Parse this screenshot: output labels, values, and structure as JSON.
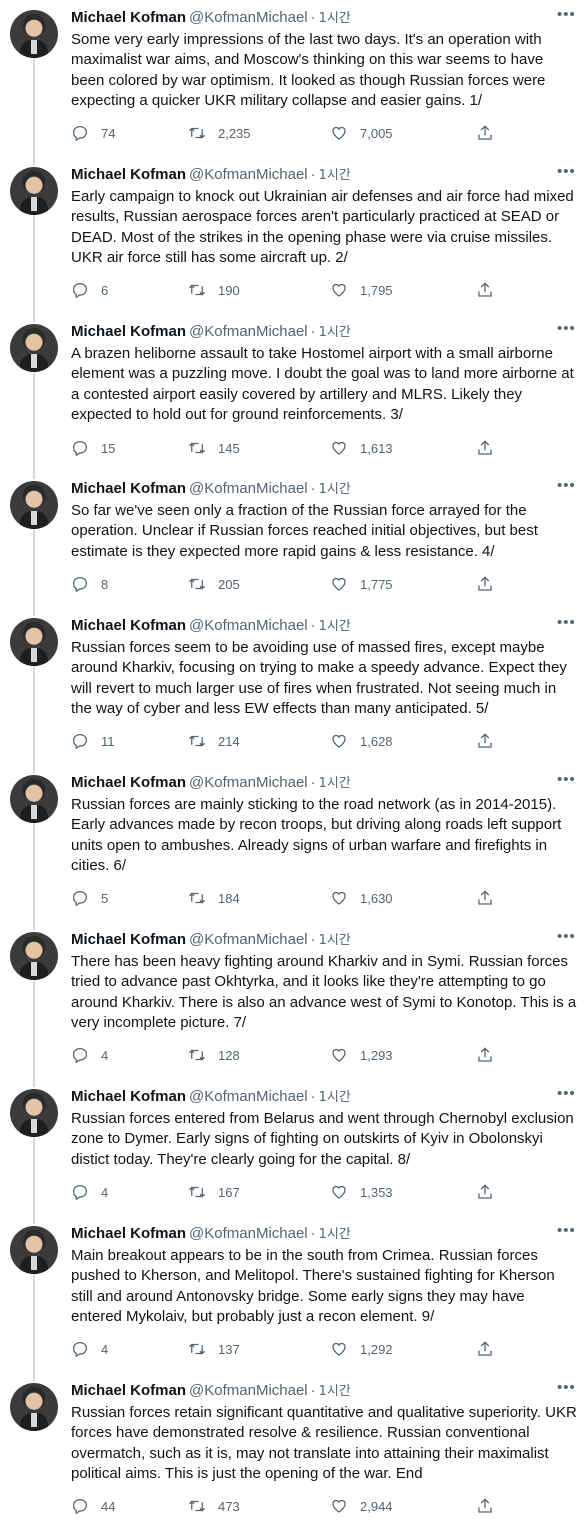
{
  "author": {
    "name": "Michael Kofman",
    "handle": "@KofmanMichael",
    "separator": "·",
    "time": "1시간"
  },
  "tweets": [
    {
      "text": "Some very early impressions of the last two days. It's an operation with maximalist war aims, and Moscow's thinking on this war seems to have been colored by war optimism. It looked as though Russian forces were expecting a quicker UKR military collapse and easier gains. 1/",
      "replies": "74",
      "retweets": "2,235",
      "likes": "7,005"
    },
    {
      "text": "Early campaign to knock out Ukrainian air defenses and air force had mixed results, Russian aerospace forces aren't particularly practiced at SEAD or DEAD. Most of the strikes in the opening phase were via cruise missiles. UKR air force still has some aircraft up. 2/",
      "replies": "6",
      "retweets": "190",
      "likes": "1,795"
    },
    {
      "text": "A brazen heliborne assault to take Hostomel airport with a small airborne element was a puzzling move. I doubt the goal was to land more airborne at a contested airport easily covered by artillery and MLRS. Likely they expected to hold out for ground reinforcements. 3/",
      "replies": "15",
      "retweets": "145",
      "likes": "1,613"
    },
    {
      "text": "So far we've seen only a fraction of the Russian force arrayed for the operation. Unclear if Russian forces reached initial objectives, but best estimate is they expected more rapid gains & less resistance. 4/",
      "replies": "8",
      "retweets": "205",
      "likes": "1,775"
    },
    {
      "text": "Russian forces seem to be avoiding use of massed fires, except maybe around Kharkiv, focusing on trying to make a speedy advance. Expect they will revert to much larger use of fires when frustrated. Not seeing much in the way of cyber and less EW effects than many anticipated. 5/",
      "replies": "11",
      "retweets": "214",
      "likes": "1,628"
    },
    {
      "text": "Russian forces are mainly sticking to the road network (as in 2014-2015). Early advances made by recon troops, but driving along roads left support units open to ambushes. Already signs of urban warfare and firefights in cities. 6/",
      "replies": "5",
      "retweets": "184",
      "likes": "1,630"
    },
    {
      "text": "There has been heavy fighting around Kharkiv and in Symi. Russian forces tried to advance past Okhtyrka, and it looks like they're attempting to go around Kharkiv. There is also an advance west of Symi to Konotop. This is a very incomplete picture. 7/",
      "replies": "4",
      "retweets": "128",
      "likes": "1,293"
    },
    {
      "text": "Russian forces entered from Belarus and went through Chernobyl exclusion zone to Dymer. Early signs of fighting on outskirts of Kyiv in Obolonskyi distict today. They're clearly going for the capital. 8/",
      "replies": "4",
      "retweets": "167",
      "likes": "1,353"
    },
    {
      "text": "Main breakout appears to be in the south from Crimea. Russian forces pushed to Kherson, and Melitopol. There's sustained fighting for Kherson still and around Antonovsky bridge. Some early signs they may have entered Mykolaiv, but probably just a recon element. 9/",
      "replies": "4",
      "retweets": "137",
      "likes": "1,292"
    },
    {
      "text": "Russian forces retain significant quantitative and qualitative superiority. UKR forces have demonstrated resolve & resilience. Russian conventional overmatch, such as it is, may not translate into attaining their maximalist political aims. This is just the opening of the war. End",
      "replies": "44",
      "retweets": "473",
      "likes": "2,944"
    }
  ],
  "icons": {
    "reply": "reply-icon",
    "retweet": "retweet-icon",
    "like": "heart-icon",
    "share": "share-icon",
    "more": "more-icon"
  },
  "colors": {
    "text": "#0f1419",
    "secondary": "#536471",
    "thread_line": "#cfd9de"
  }
}
